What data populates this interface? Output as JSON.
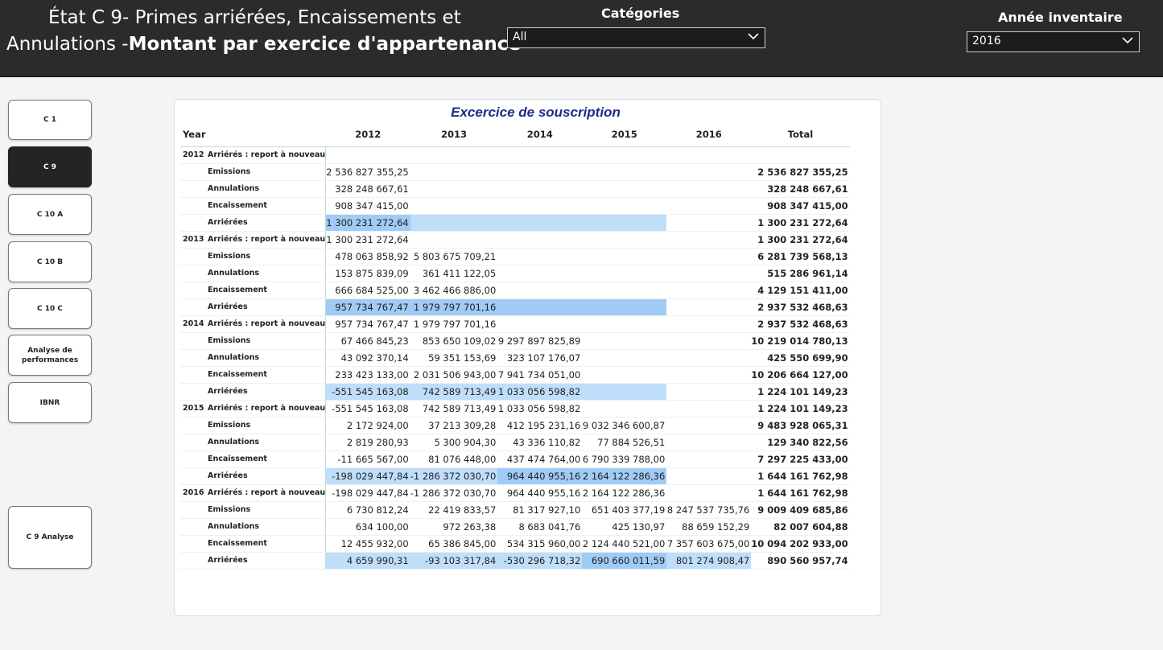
{
  "header": {
    "title_line1": "État C 9- Primes arriérées, Encaissements et",
    "title_line2_prefix": "Annulations -",
    "title_line2_bold": "Montant par exercice d'appartenance",
    "categories_label": "Catégories",
    "categories_value": "All",
    "year_label": "Année inventaire",
    "year_value": "2016"
  },
  "nav": [
    "C 1",
    "C 9",
    "C 10 A",
    "C 10 B",
    "C 10 C",
    "Analyse de performances",
    "IBNR",
    "C 9 Analyse"
  ],
  "matrix": {
    "title": "Excercice de souscription",
    "year_header": "Year",
    "columns": [
      "2012",
      "2013",
      "2014",
      "2015",
      "2016"
    ],
    "total_header": "Total",
    "rows": [
      {
        "year": "2012",
        "label": "Arriérés : report à nouveau",
        "values": [
          "",
          "",
          "",
          "",
          ""
        ],
        "total": ""
      },
      {
        "year": "",
        "label": "Emissions",
        "values": [
          "2 536 827 355,25",
          "",
          "",
          "",
          ""
        ],
        "total": "2 536 827 355,25"
      },
      {
        "year": "",
        "label": "Annulations",
        "values": [
          "328 248 667,61",
          "",
          "",
          "",
          ""
        ],
        "total": "328 248 667,61"
      },
      {
        "year": "",
        "label": "Encaissement",
        "values": [
          "908 347 415,00",
          "",
          "",
          "",
          ""
        ],
        "total": "908 347 415,00"
      },
      {
        "year": "",
        "label": "Arriérées",
        "values": [
          "1 300 231 272,64",
          "",
          "",
          "",
          ""
        ],
        "total": "1 300 231 272,64"
      },
      {
        "year": "2013",
        "label": "Arriérés : report à nouveau",
        "values": [
          "1 300 231 272,64",
          "",
          "",
          "",
          ""
        ],
        "total": "1 300 231 272,64"
      },
      {
        "year": "",
        "label": "Emissions",
        "values": [
          "478 063 858,92",
          "5 803 675 709,21",
          "",
          "",
          ""
        ],
        "total": "6 281 739 568,13"
      },
      {
        "year": "",
        "label": "Annulations",
        "values": [
          "153 875 839,09",
          "361 411 122,05",
          "",
          "",
          ""
        ],
        "total": "515 286 961,14"
      },
      {
        "year": "",
        "label": "Encaissement",
        "values": [
          "666 684 525,00",
          "3 462 466 886,00",
          "",
          "",
          ""
        ],
        "total": "4 129 151 411,00"
      },
      {
        "year": "",
        "label": "Arriérées",
        "values": [
          "957 734 767,47",
          "1 979 797 701,16",
          "",
          "",
          ""
        ],
        "total": "2 937 532 468,63"
      },
      {
        "year": "2014",
        "label": "Arriérés : report à nouveau",
        "values": [
          "957 734 767,47",
          "1 979 797 701,16",
          "",
          "",
          ""
        ],
        "total": "2 937 532 468,63"
      },
      {
        "year": "",
        "label": "Emissions",
        "values": [
          "67 466 845,23",
          "853 650 109,02",
          "9 297 897 825,89",
          "",
          ""
        ],
        "total": "10 219 014 780,13"
      },
      {
        "year": "",
        "label": "Annulations",
        "values": [
          "43 092 370,14",
          "59 351 153,69",
          "323 107 176,07",
          "",
          ""
        ],
        "total": "425 550 699,90"
      },
      {
        "year": "",
        "label": "Encaissement",
        "values": [
          "233 423 133,00",
          "2 031 506 943,00",
          "7 941 734 051,00",
          "",
          ""
        ],
        "total": "10 206 664 127,00"
      },
      {
        "year": "",
        "label": "Arriérées",
        "values": [
          "-551 545 163,08",
          "742 589 713,49",
          "1 033 056 598,82",
          "",
          ""
        ],
        "total": "1 224 101 149,23"
      },
      {
        "year": "2015",
        "label": "Arriérés : report à nouveau",
        "values": [
          "-551 545 163,08",
          "742 589 713,49",
          "1 033 056 598,82",
          "",
          ""
        ],
        "total": "1 224 101 149,23"
      },
      {
        "year": "",
        "label": "Emissions",
        "values": [
          "2 172 924,00",
          "37 213 309,28",
          "412 195 231,16",
          "9 032 346 600,87",
          ""
        ],
        "total": "9 483 928 065,31"
      },
      {
        "year": "",
        "label": "Annulations",
        "values": [
          "2 819 280,93",
          "5 300 904,30",
          "43 336 110,82",
          "77 884 526,51",
          ""
        ],
        "total": "129 340 822,56"
      },
      {
        "year": "",
        "label": "Encaissement",
        "values": [
          "-11 665 567,00",
          "81 076 448,00",
          "437 474 764,00",
          "6 790 339 788,00",
          ""
        ],
        "total": "7 297 225 433,00"
      },
      {
        "year": "",
        "label": "Arriérées",
        "values": [
          "-198 029 447,84",
          "-1 286 372 030,70",
          "964 440 955,16",
          "2 164 122 286,36",
          ""
        ],
        "total": "1 644 161 762,98"
      },
      {
        "year": "2016",
        "label": "Arriérés : report à nouveau",
        "values": [
          "-198 029 447,84",
          "-1 286 372 030,70",
          "964 440 955,16",
          "2 164 122 286,36",
          ""
        ],
        "total": "1 644 161 762,98"
      },
      {
        "year": "",
        "label": "Emissions",
        "values": [
          "6 730 812,24",
          "22 419 833,57",
          "81 317 927,10",
          "651 403 377,19",
          "8 247 537 735,76"
        ],
        "total": "9 009 409 685,86"
      },
      {
        "year": "",
        "label": "Annulations",
        "values": [
          "634 100,00",
          "972 263,38",
          "8 683 041,76",
          "425 130,97",
          "88 659 152,29"
        ],
        "total": "82 007 604,88"
      },
      {
        "year": "",
        "label": "Encaissement",
        "values": [
          "12 455 932,00",
          "65 386 845,00",
          "534 315 960,00",
          "2 124 440 521,00",
          "7 357 603 675,00"
        ],
        "total": "10 094 202 933,00"
      },
      {
        "year": "",
        "label": "Arriérées",
        "values": [
          "4 659 990,31",
          "-93 103 317,84",
          "-530 296 718,32",
          "690 660 011,59",
          "801 274 908,47"
        ],
        "total": "890 560 957,74"
      }
    ]
  }
}
